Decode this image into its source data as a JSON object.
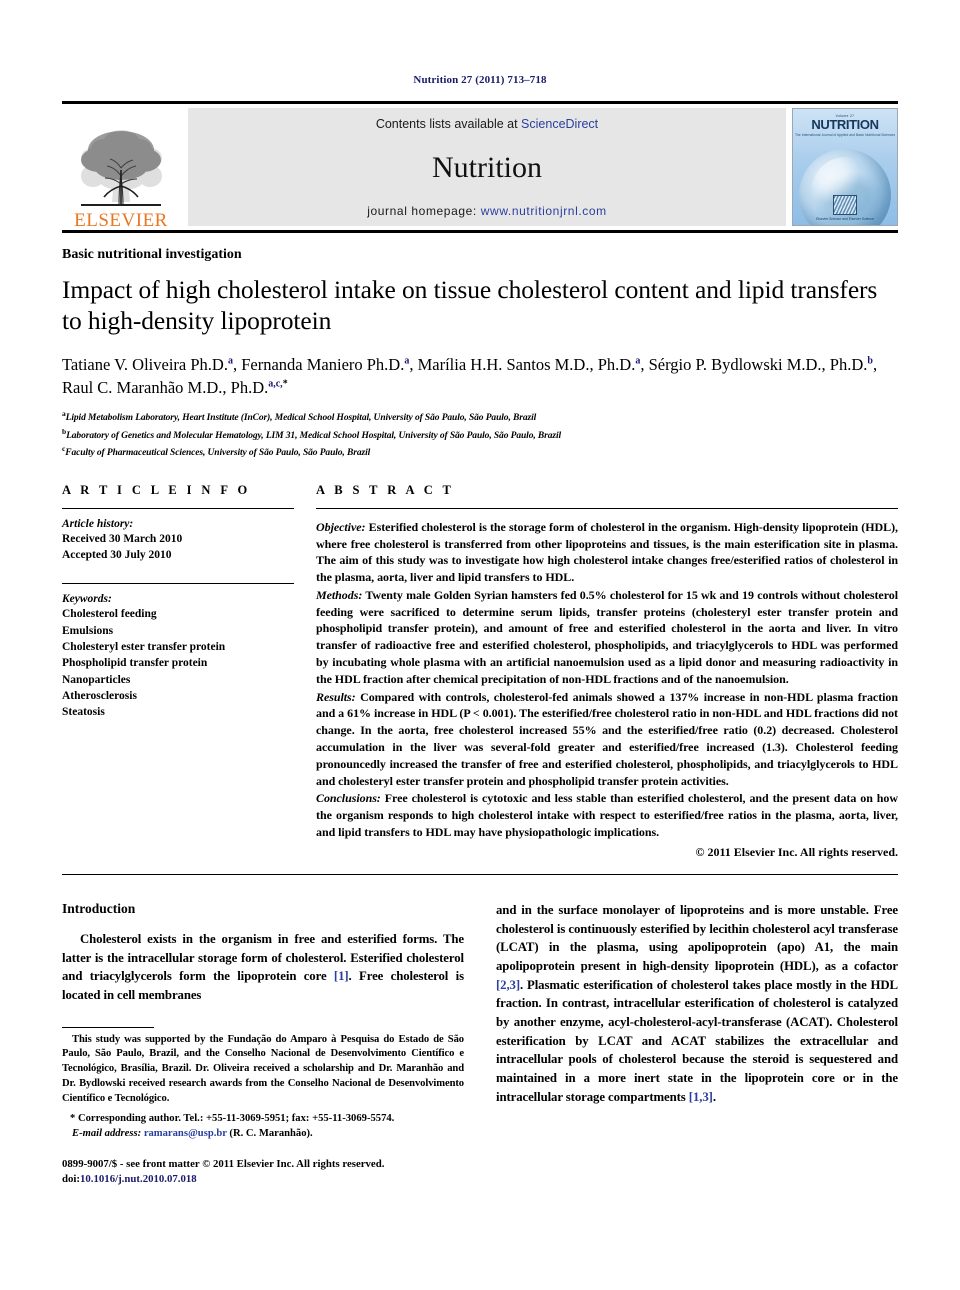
{
  "running_head": "Nutrition 27 (2011) 713–718",
  "masthead": {
    "publisher": "ELSEVIER",
    "contents_prefix": "Contents lists available at ",
    "contents_link": "ScienceDirect",
    "journal_name": "Nutrition",
    "homepage_prefix": "journal homepage: ",
    "homepage_url": "www.nutritionjrnl.com",
    "cover": {
      "volume_line": "Volume 27",
      "title": "NUTRITION",
      "subtitle": "The International Journal of Applied and Basic Nutritional Sciences",
      "publisher_mark": "Elsevier Science and Elsevier Science"
    }
  },
  "article": {
    "section_label": "Basic nutritional investigation",
    "title": "Impact of high cholesterol intake on tissue cholesterol content and lipid transfers to high-density lipoprotein",
    "authors": [
      {
        "name": "Tatiane V. Oliveira Ph.D.",
        "sup": "a",
        "sep": ", "
      },
      {
        "name": "Fernanda Maniero Ph.D.",
        "sup": "a",
        "sep": ", "
      },
      {
        "name": "Marília H.H. Santos M.D., Ph.D.",
        "sup": "a",
        "sep": ", "
      },
      {
        "name": "Sérgio P. Bydlowski M.D., Ph.D.",
        "sup": "b",
        "sep": ", "
      },
      {
        "name": "Raul C. Maranhão M.D., Ph.D.",
        "sup": "a,c,",
        "sup_star": "*",
        "sep": ""
      }
    ],
    "affiliations": [
      {
        "marker": "a",
        "text": "Lipid Metabolism Laboratory, Heart Institute (InCor), Medical School Hospital, University of São Paulo, São Paulo, Brazil"
      },
      {
        "marker": "b",
        "text": "Laboratory of Genetics and Molecular Hematology, LIM 31, Medical School Hospital, University of São Paulo, São Paulo, Brazil"
      },
      {
        "marker": "c",
        "text": "Faculty of Pharmaceutical Sciences, University of São Paulo, São Paulo, Brazil"
      }
    ]
  },
  "article_info": {
    "heading": "A R T I C L E   I N F O",
    "history_label": "Article history:",
    "history_lines": [
      "Received 30 March 2010",
      "Accepted 30 July 2010"
    ],
    "keywords_label": "Keywords:",
    "keywords": [
      "Cholesterol feeding",
      "Emulsions",
      "Cholesteryl ester transfer protein",
      "Phospholipid transfer protein",
      "Nanoparticles",
      "Atherosclerosis",
      "Steatosis"
    ]
  },
  "abstract": {
    "heading": "A B S T R A C T",
    "objective_label": "Objective:",
    "objective_text": " Esterified cholesterol is the storage form of cholesterol in the organism. High-density lipoprotein (HDL), where free cholesterol is transferred from other lipoproteins and tissues, is the main esterification site in plasma. The aim of this study was to investigate how high cholesterol intake changes free/esterified ratios of cholesterol in the plasma, aorta, liver and lipid transfers to HDL.",
    "methods_label": "Methods:",
    "methods_text": " Twenty male Golden Syrian hamsters fed 0.5% cholesterol for 15 wk and 19 controls without cholesterol feeding were sacrificed to determine serum lipids, transfer proteins (cholesteryl ester transfer protein and phospholipid transfer protein), and amount of free and esterified cholesterol in the aorta and liver. In vitro transfer of radioactive free and esterified cholesterol, phospholipids, and triacylglycerols to HDL was performed by incubating whole plasma with an artificial nanoemulsion used as a lipid donor and measuring radioactivity in the HDL fraction after chemical precipitation of non-HDL fractions and of the nanoemulsion.",
    "results_label": "Results:",
    "results_text": " Compared with controls, cholesterol-fed animals showed a 137% increase in non-HDL plasma fraction and a 61% increase in HDL (P < 0.001). The esterified/free cholesterol ratio in non-HDL and HDL fractions did not change. In the aorta, free cholesterol increased 55% and the esterified/free ratio (0.2) decreased. Cholesterol accumulation in the liver was several-fold greater and esterified/free increased (1.3). Cholesterol feeding pronouncedly increased the transfer of free and esterified cholesterol, phospholipids, and triacylglycerols to HDL and cholesteryl ester transfer protein and phospholipid transfer protein activities.",
    "conclusions_label": "Conclusions:",
    "conclusions_text": " Free cholesterol is cytotoxic and less stable than esterified cholesterol, and the present data on how the organism responds to high cholesterol intake with respect to esterified/free ratios in the plasma, aorta, liver, and lipid transfers to HDL may have physiopathologic implications.",
    "copyright": "© 2011 Elsevier Inc. All rights reserved."
  },
  "introduction": {
    "heading": "Introduction",
    "left_paragraph_pre": "Cholesterol exists in the organism in free and esterified forms. The latter is the intracellular storage form of cholesterol. Esterified cholesterol and triacylglycerols form the lipoprotein core ",
    "left_ref_1": "[1]",
    "left_paragraph_post": ". Free cholesterol is located in cell membranes",
    "right_paragraph_pre": "and in the surface monolayer of lipoproteins and is more unstable. Free cholesterol is continuously esterified by lecithin cholesterol acyl transferase (LCAT) in the plasma, using apolipoprotein (apo) A1, the main apolipoprotein present in high-density lipoprotein (HDL), as a cofactor ",
    "right_ref_1": "[2,3]",
    "right_paragraph_mid": ". Plasmatic esterification of cholesterol takes place mostly in the HDL fraction. In contrast, intracellular esterification of cholesterol is catalyzed by another enzyme, acyl-cholesterol-acyl-transferase (ACAT). Cholesterol esterification by LCAT and ACAT stabilizes the extracellular and intracellular pools of cholesterol because the steroid is sequestered and maintained in a more inert state in the lipoprotein core or in the intracellular storage compartments ",
    "right_ref_2": "[1,3]",
    "right_paragraph_post": "."
  },
  "footnotes": {
    "funding": "This study was supported by the Fundação do Amparo à Pesquisa do Estado de São Paulo, São Paulo, Brazil, and the Conselho Nacional de Desenvolvimento Científico e Tecnológico, Brasília, Brazil. Dr. Oliveira received a scholarship and Dr. Maranhão and Dr. Bydlowski received research awards from the Conselho Nacional de Desenvolvimento Científico e Tecnológico.",
    "corresponding_marker": "*",
    "corresponding_text": "Corresponding author. Tel.: +55-11-3069-5951; fax: +55-11-3069-5574.",
    "email_label": "E-mail address:",
    "email": "ramarans@usp.br",
    "email_owner": "(R. C. Maranhão)."
  },
  "imprint": {
    "issn_line": "0899-9007/$ - see front matter © 2011 Elsevier Inc. All rights reserved.",
    "doi_label": "doi:",
    "doi": "10.1016/j.nut.2010.07.018"
  },
  "colors": {
    "link": "#2a3f9d",
    "running_head": "#1a1a6e",
    "elsevier_orange": "#E87722"
  }
}
